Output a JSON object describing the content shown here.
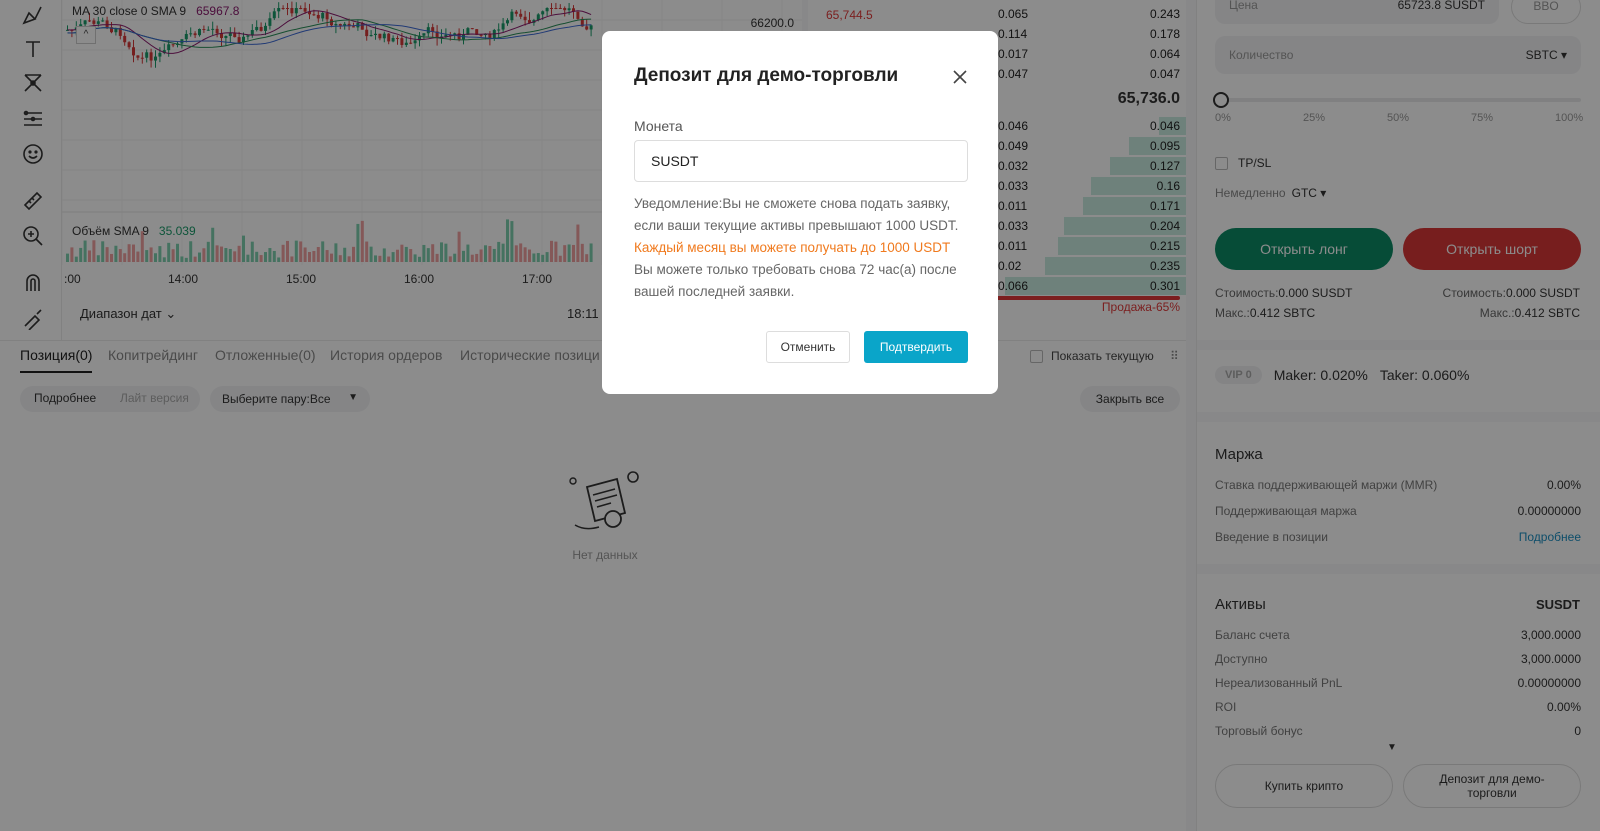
{
  "chart": {
    "ma_label": "MA 30 close 0 SMA 9",
    "ma_value": "65967.8",
    "volume_label": "Объём SMA 9",
    "volume_value": "35.039",
    "price_scale_top": "66200.0",
    "time_ticks": [
      ":00",
      "14:00",
      "15:00",
      "16:00",
      "17:00"
    ],
    "date_range": "Диапазон дат",
    "clock": "18:11"
  },
  "orderbook": {
    "ask_top_price": "65,744.5",
    "asks": [
      {
        "amount": "0.065",
        "total": "0.243"
      },
      {
        "amount": "0.114",
        "total": "0.178"
      },
      {
        "amount": "0.017",
        "total": "0.064"
      },
      {
        "amount": "0.047",
        "total": "0.047"
      }
    ],
    "mid_price": "65,736.0",
    "bids": [
      {
        "amount": "0.046",
        "total": "0.046",
        "fill": 0.13
      },
      {
        "amount": "0.049",
        "total": "0.095",
        "fill": 0.27
      },
      {
        "amount": "0.032",
        "total": "0.127",
        "fill": 0.36
      },
      {
        "amount": "0.033",
        "total": "0.16",
        "fill": 0.45
      },
      {
        "amount": "0.011",
        "total": "0.171",
        "fill": 0.49
      },
      {
        "amount": "0.033",
        "total": "0.204",
        "fill": 0.58
      },
      {
        "amount": "0.011",
        "total": "0.215",
        "fill": 0.61
      },
      {
        "amount": "0.02",
        "total": "0.235",
        "fill": 0.67
      },
      {
        "amount": "0.066",
        "total": "0.301",
        "fill": 0.86
      }
    ],
    "sell_pct": "Продажа-65%",
    "colors": {
      "ask": "#e03a3a",
      "bid_bar": "#c9ece0"
    }
  },
  "positions": {
    "tabs": [
      "Позиция(0)",
      "Копитрейдинг",
      "Отложенные(0)",
      "История ордеров",
      "Исторические позици"
    ],
    "show_current": "Показать текущую",
    "seg_detailed": "Подробнее",
    "seg_lite": "Лайт версия",
    "pair_select": "Выберите пару:Все",
    "close_all": "Закрыть все",
    "empty_text": "Нет данных"
  },
  "panel": {
    "price_label": "Цена",
    "price_value": "65723.8 SUSDT",
    "bbo": "BBO",
    "qty_label": "Количество",
    "qty_unit": "SBTC ▾",
    "slider_ticks": [
      "0%",
      "25%",
      "50%",
      "75%",
      "100%"
    ],
    "tpsl": "TP/SL",
    "tif_label": "Немедленно",
    "tif_value": "GTC ▾",
    "open_long": "Открыть лонг",
    "open_short": "Открыть шорт",
    "cost_left_label": "Стоимость:",
    "cost_left_value": "0.000 SUSDT",
    "cost_right_label": "Стоимость:",
    "cost_right_value": "0.000 SUSDT",
    "max_left_label": "Макс.:",
    "max_left_value": "0.412 SBTC",
    "max_right_label": "Макс.:",
    "max_right_value": "0.412 SBTC",
    "vip": "VIP 0",
    "maker": "Maker: 0.020%",
    "taker": "Taker: 0.060%",
    "margin_title": "Маржа",
    "margin_rows": [
      {
        "k": "Ставка поддерживающей маржи (MMR)",
        "v": "0.00%"
      },
      {
        "k": "Поддерживающая маржа",
        "v": "0.00000000"
      },
      {
        "k": "Введение в позиции",
        "v": "Подробнее"
      }
    ],
    "assets_title": "Активы",
    "assets_currency": "SUSDT",
    "asset_rows": [
      {
        "k": "Баланс счета",
        "v": "3,000.0000"
      },
      {
        "k": "Доступно",
        "v": "3,000.0000"
      },
      {
        "k": "Нереализованный PnL",
        "v": "0.00000000"
      },
      {
        "k": "ROI",
        "v": "0.00%"
      },
      {
        "k": "Торговый бонус",
        "v": "0"
      }
    ],
    "buy_crypto": "Купить крипто",
    "demo_deposit": "Депозит для демо-торговли"
  },
  "modal": {
    "title": "Депозит для демо-торговли",
    "coin_label": "Монета",
    "coin_value": "SUSDT",
    "notice_1": "Уведомление:Вы не сможете снова подать заявку, если ваши текущие активы превышают 1000 USDT.",
    "notice_2": "Каждый месяц вы можете получать до 1000 USDT",
    "notice_3": "Вы можете только требовать снова 72 час(а) после вашей последней заявки.",
    "cancel": "Отменить",
    "confirm": "Подтвердить"
  },
  "colors": {
    "long": "#0b8a64",
    "short": "#d93838",
    "confirm": "#0aa5c9",
    "notice_highlight": "#f07a1e"
  }
}
